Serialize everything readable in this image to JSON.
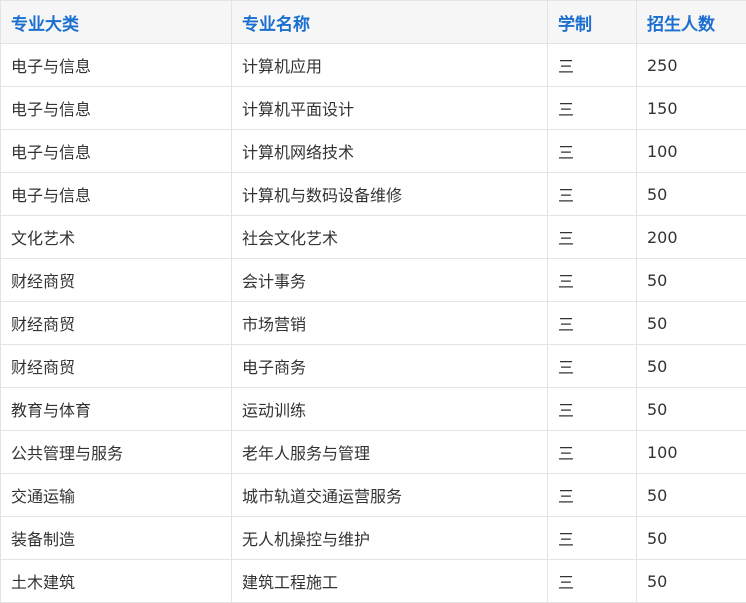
{
  "table": {
    "headers": [
      "专业大类",
      "专业名称",
      "学制",
      "招生人数"
    ],
    "rows": [
      [
        "电子与信息",
        "计算机应用",
        "三",
        "250"
      ],
      [
        "电子与信息",
        "计算机平面设计",
        "三",
        "150"
      ],
      [
        "电子与信息",
        "计算机网络技术",
        "三",
        "100"
      ],
      [
        "电子与信息",
        "计算机与数码设备维修",
        "三",
        "50"
      ],
      [
        "文化艺术",
        "社会文化艺术",
        "三",
        "200"
      ],
      [
        "财经商贸",
        "会计事务",
        "三",
        "50"
      ],
      [
        "财经商贸",
        "市场营销",
        "三",
        "50"
      ],
      [
        "财经商贸",
        "电子商务",
        "三",
        "50"
      ],
      [
        "教育与体育",
        "运动训练",
        "三",
        "50"
      ],
      [
        "公共管理与服务",
        "老年人服务与管理",
        "三",
        "100"
      ],
      [
        "交通运输",
        "城市轨道交通运营服务",
        "三",
        "50"
      ],
      [
        "装备制造",
        "无人机操控与维护",
        "三",
        "50"
      ],
      [
        "土木建筑",
        "建筑工程施工",
        "三",
        "50"
      ]
    ]
  },
  "colors": {
    "header_text": "#1a6fd0",
    "header_background": "#f6f6f6",
    "cell_text": "#333333",
    "border": "#e3e3e3"
  }
}
